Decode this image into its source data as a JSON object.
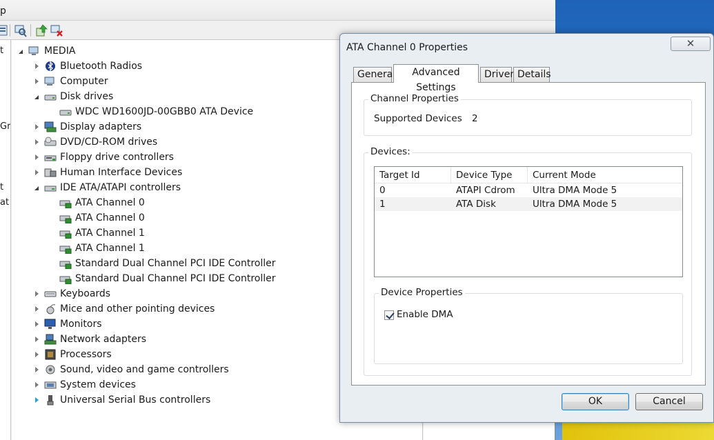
{
  "device_manager": {
    "title_fragment": "p",
    "left_pane_fragments": [
      "t",
      "Gr",
      "t",
      "at"
    ],
    "tree": {
      "root": "MEDIA",
      "items": [
        {
          "label": "Bluetooth Radios",
          "icon": "bluetooth-icon",
          "state": "collapsed",
          "level": 1
        },
        {
          "label": "Computer",
          "icon": "computer-icon",
          "state": "collapsed",
          "level": 1
        },
        {
          "label": "Disk drives",
          "icon": "disk-drive-icon",
          "state": "expanded",
          "level": 1
        },
        {
          "label": "WDC WD1600JD-00GBB0 ATA Device",
          "icon": "disk-drive-icon",
          "state": "leaf",
          "level": 2
        },
        {
          "label": "Display adapters",
          "icon": "display-adapter-icon",
          "state": "collapsed",
          "level": 1
        },
        {
          "label": "DVD/CD-ROM drives",
          "icon": "dvd-drive-icon",
          "state": "collapsed",
          "level": 1
        },
        {
          "label": "Floppy drive controllers",
          "icon": "floppy-controller-icon",
          "state": "collapsed",
          "level": 1
        },
        {
          "label": "Human Interface Devices",
          "icon": "hid-icon",
          "state": "collapsed",
          "level": 1
        },
        {
          "label": "IDE ATA/ATAPI controllers",
          "icon": "ide-controller-icon",
          "state": "expanded",
          "level": 1
        },
        {
          "label": "ATA Channel 0",
          "icon": "ide-channel-icon",
          "state": "leaf",
          "level": 2
        },
        {
          "label": "ATA Channel 0",
          "icon": "ide-channel-icon",
          "state": "leaf",
          "level": 2
        },
        {
          "label": "ATA Channel 1",
          "icon": "ide-channel-icon",
          "state": "leaf",
          "level": 2
        },
        {
          "label": "ATA Channel 1",
          "icon": "ide-channel-icon",
          "state": "leaf",
          "level": 2
        },
        {
          "label": "Standard Dual Channel PCI IDE Controller",
          "icon": "ide-channel-icon",
          "state": "leaf",
          "level": 2
        },
        {
          "label": "Standard Dual Channel PCI IDE Controller",
          "icon": "ide-channel-icon",
          "state": "leaf",
          "level": 2
        },
        {
          "label": "Keyboards",
          "icon": "keyboard-icon",
          "state": "collapsed",
          "level": 1
        },
        {
          "label": "Mice and other pointing devices",
          "icon": "mouse-icon",
          "state": "collapsed",
          "level": 1
        },
        {
          "label": "Monitors",
          "icon": "monitor-icon",
          "state": "collapsed",
          "level": 1
        },
        {
          "label": "Network adapters",
          "icon": "network-adapter-icon",
          "state": "collapsed",
          "level": 1
        },
        {
          "label": "Processors",
          "icon": "processor-icon",
          "state": "collapsed",
          "level": 1
        },
        {
          "label": "Sound, video and game controllers",
          "icon": "sound-icon",
          "state": "collapsed",
          "level": 1
        },
        {
          "label": "System devices",
          "icon": "system-devices-icon",
          "state": "collapsed",
          "level": 1
        },
        {
          "label": "Universal Serial Bus controllers",
          "icon": "usb-icon",
          "state": "collapsed-highlight",
          "level": 1
        }
      ]
    }
  },
  "dialog": {
    "title": "ATA Channel 0 Properties",
    "close_symbol": "✕",
    "tabs": [
      "General",
      "Advanced Settings",
      "Driver",
      "Details"
    ],
    "active_tab": "Advanced Settings",
    "channel_properties": {
      "group_label": "Channel Properties",
      "supported_devices_label": "Supported Devices",
      "supported_devices_value": "2"
    },
    "devices": {
      "group_label": "Devices:",
      "columns": [
        "Target Id",
        "Device Type",
        "Current Mode"
      ],
      "rows": [
        [
          "0",
          "ATAPI Cdrom",
          "Ultra DMA Mode 5"
        ],
        [
          "1",
          "ATA Disk",
          "Ultra DMA Mode 5"
        ]
      ]
    },
    "device_properties": {
      "group_label": "Device Properties",
      "enable_dma_label": "Enable DMA",
      "enable_dma_checked": true
    },
    "buttons": {
      "ok": "OK",
      "cancel": "Cancel"
    }
  },
  "colors": {
    "desktop_blue": "#2a76cd",
    "window_bg": "#f0f0f0",
    "dialog_bg": "#e9eef3",
    "usb_arrow": "#26a0da"
  }
}
